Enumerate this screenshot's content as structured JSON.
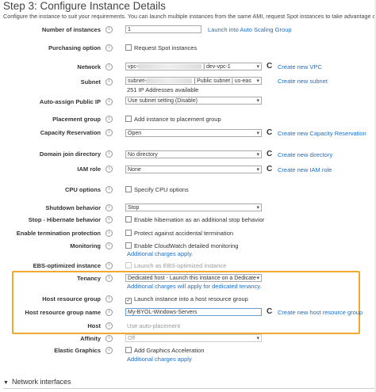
{
  "header": {
    "title": "Step 3: Configure Instance Details",
    "subtitle": "Configure the instance to suit your requirements. You can launch multiple instances from the same AMI, request Spot instances to take advantage of the l"
  },
  "fields": {
    "number_of_instances": {
      "label": "Number of instances",
      "value": "1",
      "link": "Launch into Auto Scaling Group"
    },
    "purchasing_option": {
      "label": "Purchasing option",
      "checkbox": "Request Spot instances"
    },
    "network": {
      "label": "Network",
      "value_prefix": "vpc-",
      "value_suffix": "| dev-vpc-1",
      "link": "Create new VPC"
    },
    "subnet": {
      "label": "Subnet",
      "value_prefix": "subnet-",
      "value_suffix": "| Public subnet | us-eas",
      "note": "251 IP Addresses available",
      "link": "Create new subnet"
    },
    "auto_assign_ip": {
      "label": "Auto-assign Public IP",
      "value": "Use subnet setting (Disable)"
    },
    "placement_group": {
      "label": "Placement group",
      "checkbox": "Add instance to placement group"
    },
    "capacity_reservation": {
      "label": "Capacity Reservation",
      "value": "Open",
      "link": "Create new Capacity Reservation"
    },
    "domain_join": {
      "label": "Domain join directory",
      "value": "No directory",
      "link": "Create new directory"
    },
    "iam_role": {
      "label": "IAM role",
      "value": "None",
      "link": "Create new IAM role"
    },
    "cpu_options": {
      "label": "CPU options",
      "checkbox": "Specify CPU options"
    },
    "shutdown": {
      "label": "Shutdown behavior",
      "value": "Stop"
    },
    "stop_hibernate": {
      "label": "Stop - Hibernate behavior",
      "checkbox": "Enable hibernation as an additional stop behavior"
    },
    "termination": {
      "label": "Enable termination protection",
      "checkbox": "Protect against accidental termination"
    },
    "monitoring": {
      "label": "Monitoring",
      "checkbox": "Enable CloudWatch detailed monitoring",
      "note": "Additional charges apply."
    },
    "ebs_optimized": {
      "label": "EBS-optimized instance",
      "checkbox": "Launch as EBS-optimized instance"
    },
    "tenancy": {
      "label": "Tenancy",
      "value": "Dedicated host - Launch this instance on a Dedicate",
      "note": "Additional charges will apply for dedicated tenancy."
    },
    "host_resource_group": {
      "label": "Host resource group",
      "checkbox": "Launch instance into a host resource group",
      "checked_mark": "✓"
    },
    "host_resource_group_name": {
      "label": "Host resource group name",
      "value": "My-BYOL-Windows-Servers",
      "link": "Create new host resource group"
    },
    "host": {
      "label": "Host",
      "value": "Use auto-placement"
    },
    "affinity": {
      "label": "Affinity",
      "value": "Off"
    },
    "elastic_graphics": {
      "label": "Elastic Graphics",
      "checkbox": "Add Graphics Acceleration",
      "note": "Additional charges apply"
    }
  },
  "footer": {
    "section": "Network interfaces"
  },
  "icons": {
    "info": "i",
    "refresh": "C",
    "expand": "▼"
  },
  "colors": {
    "link": "#1a6fc9",
    "highlight": "#f0a830"
  }
}
